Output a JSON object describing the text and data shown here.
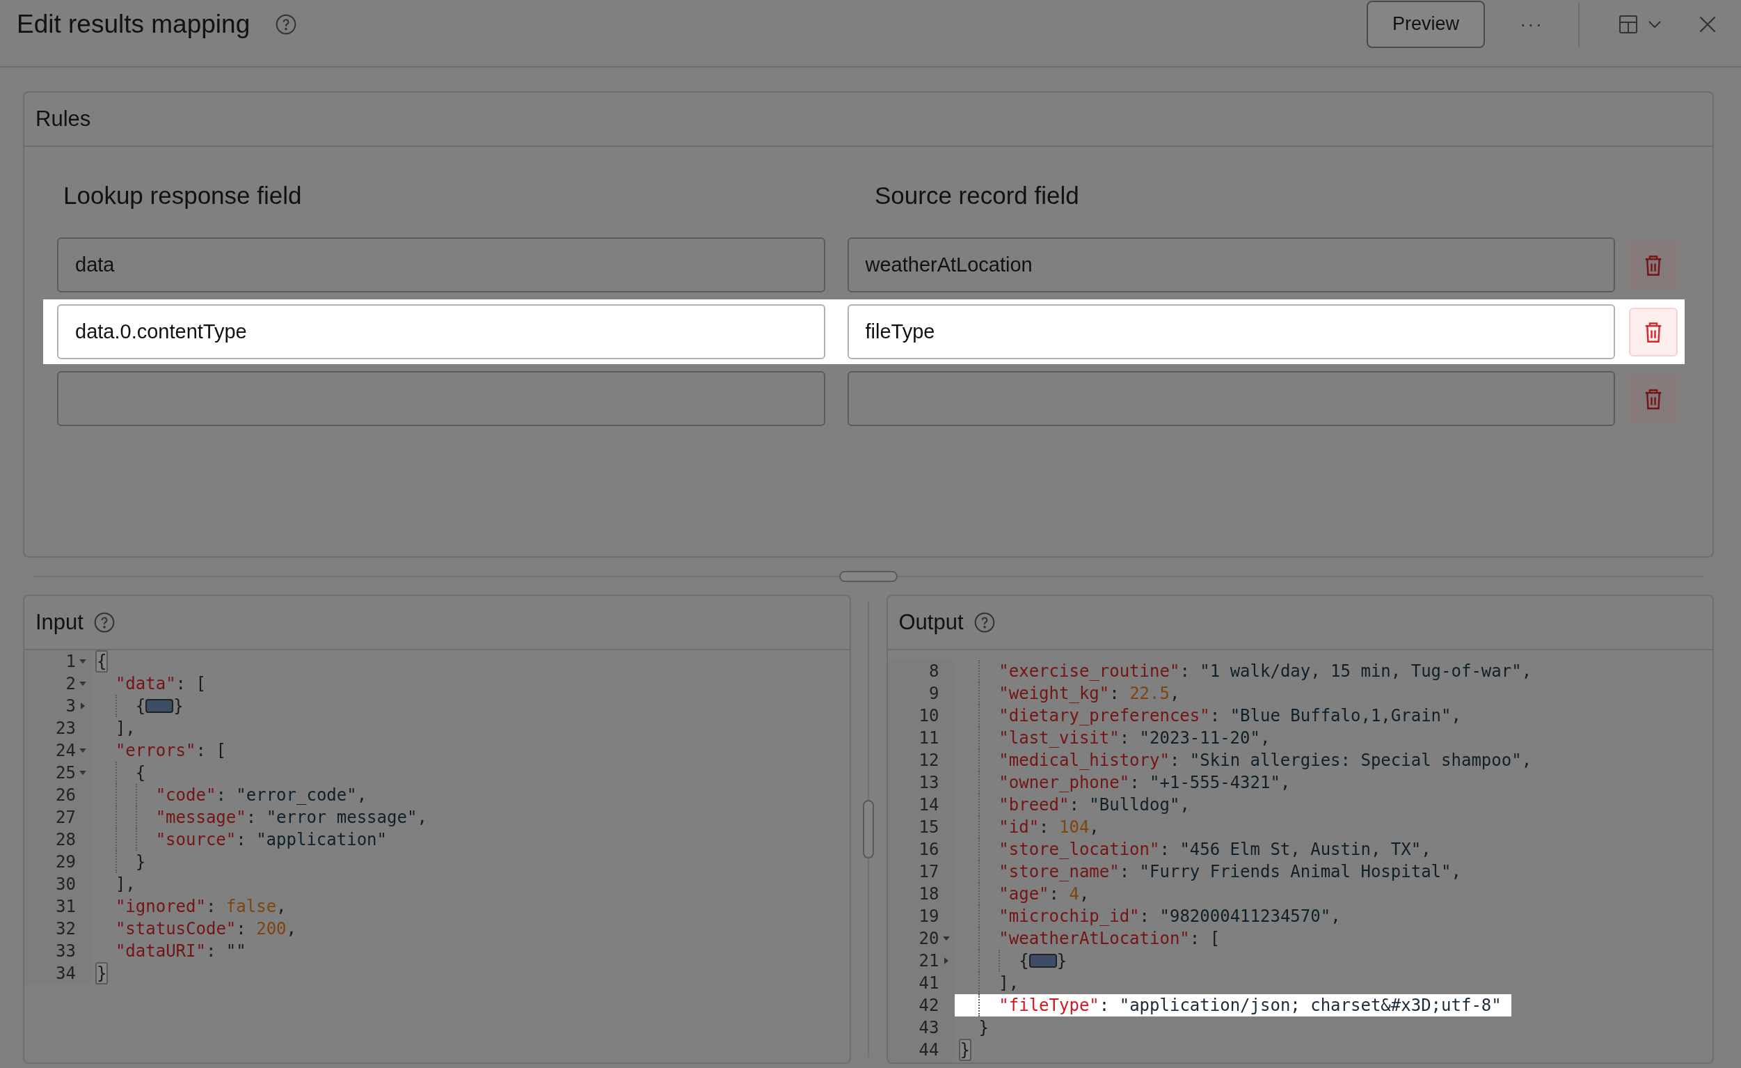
{
  "header": {
    "title": "Edit results mapping",
    "actions": {
      "preview": "Preview",
      "more": "···"
    }
  },
  "rules": {
    "title": "Rules",
    "columns": [
      "Lookup response field",
      "Source record field"
    ],
    "rows": [
      {
        "lookup": "data",
        "source": "weatherAtLocation",
        "highlighted": false
      },
      {
        "lookup": "data.0.contentType",
        "source": "fileType",
        "highlighted": true
      },
      {
        "highlighted": false
      }
    ]
  },
  "input": {
    "title": "Input",
    "lines": [
      {
        "num": "1",
        "expanded": true,
        "tokens": [
          {
            "kind": "matched-bracket",
            "text": "{"
          }
        ],
        "children": [
          {
            "num": "2",
            "expanded": true,
            "tokens": [
              {
                "kind": "key",
                "text": "\"data\""
              },
              {
                "kind": "punct",
                "text": ": ["
              }
            ],
            "children": [
              {
                "num": "3",
                "expanded": false,
                "tokens": [
                  {
                    "kind": "punct",
                    "text": "{"
                  },
                  {
                    "kind": "collapsed"
                  },
                  {
                    "kind": "punct",
                    "text": "}"
                  }
                ]
              }
            ]
          },
          {
            "num": "23",
            "tokens": [
              {
                "kind": "punct",
                "text": "],"
              }
            ]
          },
          {
            "num": "24",
            "expanded": true,
            "tokens": [
              {
                "kind": "key",
                "text": "\"errors\""
              },
              {
                "kind": "punct",
                "text": ": ["
              }
            ],
            "children": [
              {
                "num": "25",
                "expanded": true,
                "tokens": [
                  {
                    "kind": "punct",
                    "text": "{"
                  }
                ],
                "children": [
                  {
                    "num": "26",
                    "tokens": [
                      {
                        "kind": "key",
                        "text": "\"code\""
                      },
                      {
                        "kind": "punct",
                        "text": ": "
                      },
                      {
                        "kind": "string",
                        "text": "\"error_code\""
                      },
                      {
                        "kind": "punct",
                        "text": ","
                      }
                    ]
                  },
                  {
                    "num": "27",
                    "tokens": [
                      {
                        "kind": "key",
                        "text": "\"message\""
                      },
                      {
                        "kind": "punct",
                        "text": ": "
                      },
                      {
                        "kind": "string",
                        "text": "\"error message\""
                      },
                      {
                        "kind": "punct",
                        "text": ","
                      }
                    ]
                  },
                  {
                    "num": "28",
                    "tokens": [
                      {
                        "kind": "key",
                        "text": "\"source\""
                      },
                      {
                        "kind": "punct",
                        "text": ": "
                      },
                      {
                        "kind": "string",
                        "text": "\"application\""
                      }
                    ]
                  }
                ]
              },
              {
                "num": "29",
                "tokens": [
                  {
                    "kind": "punct",
                    "text": "}"
                  }
                ]
              }
            ]
          },
          {
            "num": "30",
            "tokens": [
              {
                "kind": "punct",
                "text": "],"
              }
            ]
          },
          {
            "num": "31",
            "tokens": [
              {
                "kind": "key",
                "text": "\"ignored\""
              },
              {
                "kind": "punct",
                "text": ": "
              },
              {
                "kind": "number",
                "text": "false"
              },
              {
                "kind": "punct",
                "text": ","
              }
            ]
          },
          {
            "num": "32",
            "tokens": [
              {
                "kind": "key",
                "text": "\"statusCode\""
              },
              {
                "kind": "punct",
                "text": ": "
              },
              {
                "kind": "number",
                "text": "200"
              },
              {
                "kind": "punct",
                "text": ","
              }
            ]
          },
          {
            "num": "33",
            "tokens": [
              {
                "kind": "key",
                "text": "\"dataURI\""
              },
              {
                "kind": "punct",
                "text": ": "
              },
              {
                "kind": "string",
                "text": "\"\""
              }
            ]
          }
        ]
      },
      {
        "num": "34",
        "tokens": [
          {
            "kind": "matched-bracket",
            "text": "}"
          }
        ]
      }
    ]
  },
  "output": {
    "title": "Output",
    "lines": [
      {
        "children": [
          {
            "children": [
              {
                "num": "8",
                "tokens": [
                  {
                    "kind": "key",
                    "text": "\"exercise_routine\""
                  },
                  {
                    "kind": "punct",
                    "text": ": "
                  },
                  {
                    "kind": "string",
                    "text": "\"1 walk/day, 15 min, Tug-of-war\""
                  },
                  {
                    "kind": "punct",
                    "text": ","
                  }
                ]
              },
              {
                "num": "9",
                "tokens": [
                  {
                    "kind": "key",
                    "text": "\"weight_kg\""
                  },
                  {
                    "kind": "punct",
                    "text": ": "
                  },
                  {
                    "kind": "number",
                    "text": "22.5"
                  },
                  {
                    "kind": "punct",
                    "text": ","
                  }
                ]
              },
              {
                "num": "10",
                "tokens": [
                  {
                    "kind": "key",
                    "text": "\"dietary_preferences\""
                  },
                  {
                    "kind": "punct",
                    "text": ": "
                  },
                  {
                    "kind": "string",
                    "text": "\"Blue Buffalo,1,Grain\""
                  },
                  {
                    "kind": "punct",
                    "text": ","
                  }
                ]
              },
              {
                "num": "11",
                "tokens": [
                  {
                    "kind": "key",
                    "text": "\"last_visit\""
                  },
                  {
                    "kind": "punct",
                    "text": ": "
                  },
                  {
                    "kind": "string",
                    "text": "\"2023-11-20\""
                  },
                  {
                    "kind": "punct",
                    "text": ","
                  }
                ]
              },
              {
                "num": "12",
                "tokens": [
                  {
                    "kind": "key",
                    "text": "\"medical_history\""
                  },
                  {
                    "kind": "punct",
                    "text": ": "
                  },
                  {
                    "kind": "string",
                    "text": "\"Skin allergies: Special shampoo\""
                  },
                  {
                    "kind": "punct",
                    "text": ","
                  }
                ]
              },
              {
                "num": "13",
                "tokens": [
                  {
                    "kind": "key",
                    "text": "\"owner_phone\""
                  },
                  {
                    "kind": "punct",
                    "text": ": "
                  },
                  {
                    "kind": "string",
                    "text": "\"+1-555-4321\""
                  },
                  {
                    "kind": "punct",
                    "text": ","
                  }
                ]
              },
              {
                "num": "14",
                "tokens": [
                  {
                    "kind": "key",
                    "text": "\"breed\""
                  },
                  {
                    "kind": "punct",
                    "text": ": "
                  },
                  {
                    "kind": "string",
                    "text": "\"Bulldog\""
                  },
                  {
                    "kind": "punct",
                    "text": ","
                  }
                ]
              },
              {
                "num": "15",
                "tokens": [
                  {
                    "kind": "key",
                    "text": "\"id\""
                  },
                  {
                    "kind": "punct",
                    "text": ": "
                  },
                  {
                    "kind": "number",
                    "text": "104"
                  },
                  {
                    "kind": "punct",
                    "text": ","
                  }
                ]
              },
              {
                "num": "16",
                "tokens": [
                  {
                    "kind": "key",
                    "text": "\"store_location\""
                  },
                  {
                    "kind": "punct",
                    "text": ": "
                  },
                  {
                    "kind": "string",
                    "text": "\"456 Elm St, Austin, TX\""
                  },
                  {
                    "kind": "punct",
                    "text": ","
                  }
                ]
              },
              {
                "num": "17",
                "tokens": [
                  {
                    "kind": "key",
                    "text": "\"store_name\""
                  },
                  {
                    "kind": "punct",
                    "text": ": "
                  },
                  {
                    "kind": "string",
                    "text": "\"Furry Friends Animal Hospital\""
                  },
                  {
                    "kind": "punct",
                    "text": ","
                  }
                ]
              },
              {
                "num": "18",
                "tokens": [
                  {
                    "kind": "key",
                    "text": "\"age\""
                  },
                  {
                    "kind": "punct",
                    "text": ": "
                  },
                  {
                    "kind": "number",
                    "text": "4"
                  },
                  {
                    "kind": "punct",
                    "text": ","
                  }
                ]
              },
              {
                "num": "19",
                "tokens": [
                  {
                    "kind": "key",
                    "text": "\"microchip_id\""
                  },
                  {
                    "kind": "punct",
                    "text": ": "
                  },
                  {
                    "kind": "string",
                    "text": "\"982000411234570\""
                  },
                  {
                    "kind": "punct",
                    "text": ","
                  }
                ]
              },
              {
                "num": "20",
                "expanded": true,
                "tokens": [
                  {
                    "kind": "key",
                    "text": "\"weatherAtLocation\""
                  },
                  {
                    "kind": "punct",
                    "text": ": ["
                  }
                ],
                "children": [
                  {
                    "num": "21",
                    "expanded": false,
                    "tokens": [
                      {
                        "kind": "punct",
                        "text": "{"
                      },
                      {
                        "kind": "collapsed"
                      },
                      {
                        "kind": "punct",
                        "text": "}"
                      }
                    ]
                  }
                ]
              },
              {
                "num": "41",
                "tokens": [
                  {
                    "kind": "punct",
                    "text": "],"
                  }
                ]
              },
              {
                "num": "42",
                "highlighted": true,
                "tokens": [
                  {
                    "kind": "key",
                    "text": "\"fileType\""
                  },
                  {
                    "kind": "punct",
                    "text": ": "
                  },
                  {
                    "kind": "string",
                    "text": "\"application/json; charset&#x3D;utf-8\""
                  }
                ]
              }
            ]
          },
          {
            "num": "43",
            "tokens": [
              {
                "kind": "punct",
                "text": "}"
              }
            ]
          }
        ]
      },
      {
        "num": "44",
        "tokens": [
          {
            "kind": "matched-bracket",
            "text": "}"
          }
        ]
      }
    ]
  }
}
